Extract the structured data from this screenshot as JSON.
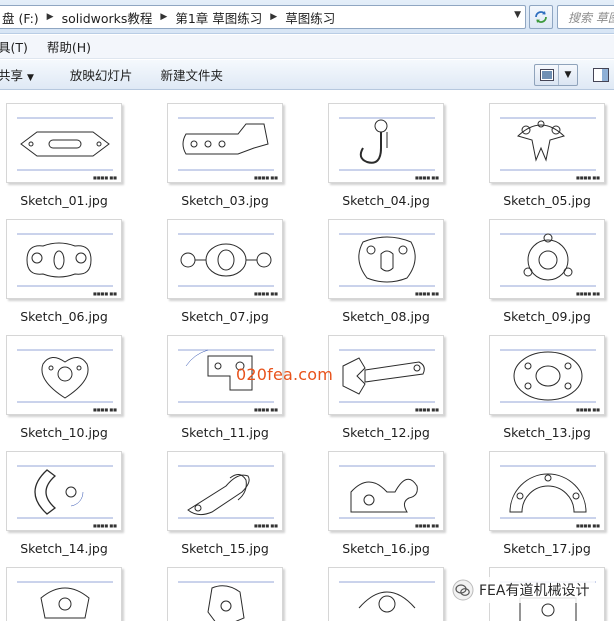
{
  "address_bar": {
    "crumbs": [
      "盘 (F:)",
      "solidworks教程",
      "第1章 草图练习",
      "草图练习"
    ]
  },
  "search": {
    "placeholder": "搜索 草图"
  },
  "menu": {
    "items": [
      "工具(T)",
      "帮助(H)"
    ]
  },
  "menu_display": [
    "具(T)",
    "帮助(H)"
  ],
  "toolbar": {
    "share_label": "共享",
    "slideshow_label": "放映幻灯片",
    "new_folder_label": "新建文件夹"
  },
  "files": [
    {
      "name": "Sketch_01.jpg"
    },
    {
      "name": "Sketch_03.jpg"
    },
    {
      "name": "Sketch_04.jpg"
    },
    {
      "name": "Sketch_05.jpg"
    },
    {
      "name": "Sketch_06.jpg"
    },
    {
      "name": "Sketch_07.jpg"
    },
    {
      "name": "Sketch_08.jpg"
    },
    {
      "name": "Sketch_09.jpg"
    },
    {
      "name": "Sketch_10.jpg"
    },
    {
      "name": "Sketch_11.jpg"
    },
    {
      "name": "Sketch_12.jpg"
    },
    {
      "name": "Sketch_13.jpg"
    },
    {
      "name": "Sketch_14.jpg"
    },
    {
      "name": "Sketch_15.jpg"
    },
    {
      "name": "Sketch_16.jpg"
    },
    {
      "name": "Sketch_17.jpg"
    },
    {
      "name": ""
    },
    {
      "name": ""
    },
    {
      "name": ""
    },
    {
      "name": ""
    }
  ],
  "watermark": {
    "center_text": "020fea.com",
    "corner_text": "FEA有道机械设计"
  },
  "colors": {
    "accent": "#3a6ea5",
    "drawing_line": "#2b2b2b",
    "dimension": "#2d4fb0",
    "watermark_orange": "#e8531c"
  }
}
